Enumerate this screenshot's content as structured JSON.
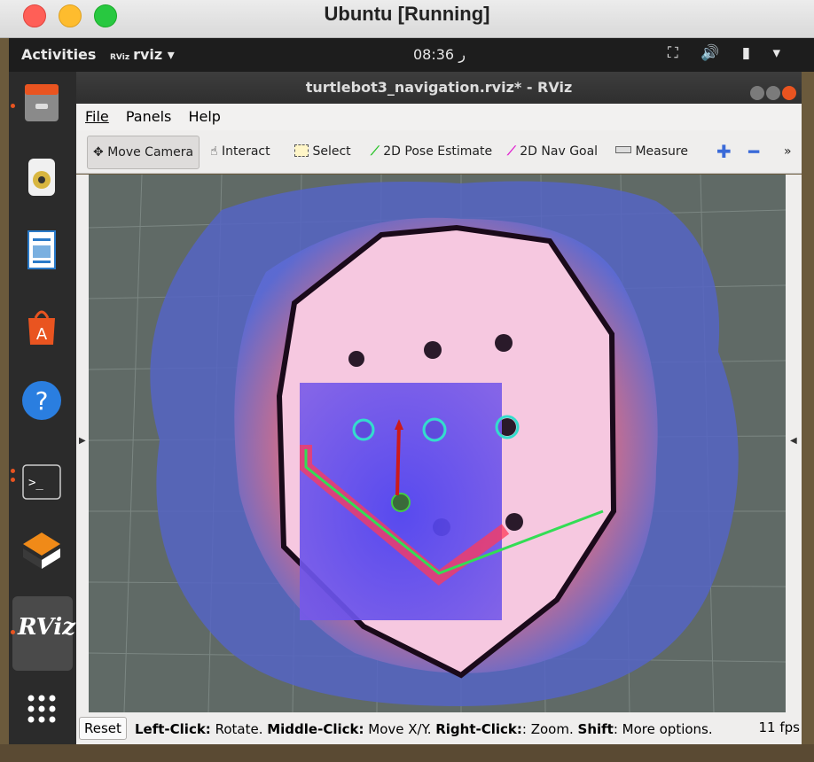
{
  "mac_window": {
    "title": "Ubuntu [Running]"
  },
  "ubuntu_topbar": {
    "activities": "Activities",
    "app_icon_text": "RViz",
    "app_name": "rviz ▾",
    "clock": "08:36 ر",
    "tray_icons": [
      "network-icon",
      "volume-icon",
      "battery-icon",
      "menu-arrow-icon"
    ],
    "tray_text": "⛶ 🔊 ▮ ▾"
  },
  "dock": {
    "items": [
      "files-icon",
      "rhythmbox-icon",
      "libreoffice-writer-icon",
      "software-center-icon",
      "help-icon",
      "terminal-icon",
      "gazebo-icon",
      "rviz-icon",
      "app-grid-icon"
    ],
    "rviz_label": "RViz"
  },
  "rviz": {
    "title": "turtlebot3_navigation.rviz* - RViz",
    "menu": [
      "File",
      "Panels",
      "Help"
    ],
    "tools": [
      {
        "label": "Move Camera",
        "icon": "move-camera-icon"
      },
      {
        "label": "Interact",
        "icon": "hand-pointer-icon"
      },
      {
        "label": "Select",
        "icon": "select-box-icon"
      },
      {
        "label": "2D Pose Estimate",
        "icon": "green-arrow-icon"
      },
      {
        "label": "2D Nav Goal",
        "icon": "magenta-arrow-icon"
      },
      {
        "label": "Measure",
        "icon": "ruler-icon"
      }
    ],
    "overflow": "»",
    "status": {
      "reset": "Reset",
      "help_parts": [
        {
          "bold": "Left-Click:",
          "text": " Rotate. "
        },
        {
          "bold": "Middle-Click:",
          "text": " Move X/Y. "
        },
        {
          "bold": "Right-Click:",
          "text": ": Zoom. "
        },
        {
          "bold": "Shift",
          "text": ": More options."
        }
      ],
      "fps": "11 fps"
    }
  },
  "colors": {
    "map_outline": "#1a0a1a",
    "costmap_blue": "#4a5ccc",
    "inflation_red": "#ff3a3a",
    "local_costmap": "#6a5cf0",
    "path_green": "#33dd55",
    "robot_arrow": "#cc1a1a"
  }
}
